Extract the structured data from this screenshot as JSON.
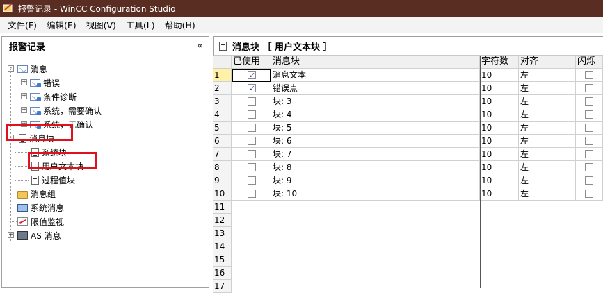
{
  "window": {
    "title": "报警记录 - WinCC Configuration Studio"
  },
  "menu": [
    "文件(F)",
    "编辑(E)",
    "视图(V)",
    "工具(L)",
    "帮助(H)"
  ],
  "navigator": {
    "title": "报警记录",
    "collapse_label": "«",
    "items": [
      {
        "label": "消息",
        "level": 0,
        "icon": "envelope-icon"
      },
      {
        "label": "错误",
        "level": 1,
        "icon": "message-class-icon"
      },
      {
        "label": "条件诊断",
        "level": 1,
        "icon": "message-class-icon"
      },
      {
        "label": "系统，需要确认",
        "level": 1,
        "icon": "message-class-icon"
      },
      {
        "label": "系统，无确认",
        "level": 1,
        "icon": "message-class-icon"
      },
      {
        "label": "消息块",
        "level": 0,
        "icon": "document-icon"
      },
      {
        "label": "系统块",
        "level": 1,
        "icon": "document-icon"
      },
      {
        "label": "用户文本块",
        "level": 1,
        "icon": "document-icon"
      },
      {
        "label": "过程值块",
        "level": 1,
        "icon": "document-icon"
      },
      {
        "label": "消息组",
        "level": 0,
        "icon": "folder-icon"
      },
      {
        "label": "系统消息",
        "level": 0,
        "icon": "system-message-icon"
      },
      {
        "label": "限值监视",
        "level": 0,
        "icon": "limit-monitoring-icon"
      },
      {
        "label": "AS 消息",
        "level": 0,
        "icon": "as-message-icon"
      }
    ]
  },
  "editor": {
    "title": "消息块 ［ 用户文本块 ］",
    "columns": [
      "已使用",
      "消息块",
      "字符数",
      "对齐",
      "闪烁"
    ],
    "rows": [
      {
        "num": "1",
        "used": true,
        "name": "消息文本",
        "chars": "10",
        "align": "左"
      },
      {
        "num": "2",
        "used": true,
        "name": "错误点",
        "chars": "10",
        "align": "左"
      },
      {
        "num": "3",
        "used": false,
        "name": "块: 3",
        "chars": "10",
        "align": "左"
      },
      {
        "num": "4",
        "used": false,
        "name": "块: 4",
        "chars": "10",
        "align": "左"
      },
      {
        "num": "5",
        "used": false,
        "name": "块: 5",
        "chars": "10",
        "align": "左"
      },
      {
        "num": "6",
        "used": false,
        "name": "块: 6",
        "chars": "10",
        "align": "左"
      },
      {
        "num": "7",
        "used": false,
        "name": "块: 7",
        "chars": "10",
        "align": "左"
      },
      {
        "num": "8",
        "used": false,
        "name": "块: 8",
        "chars": "10",
        "align": "左"
      },
      {
        "num": "9",
        "used": false,
        "name": "块: 9",
        "chars": "10",
        "align": "左"
      },
      {
        "num": "10",
        "used": false,
        "name": "块: 10",
        "chars": "10",
        "align": "左"
      }
    ],
    "empty_rows": [
      "11",
      "12",
      "13",
      "14",
      "15",
      "16",
      "17"
    ]
  }
}
